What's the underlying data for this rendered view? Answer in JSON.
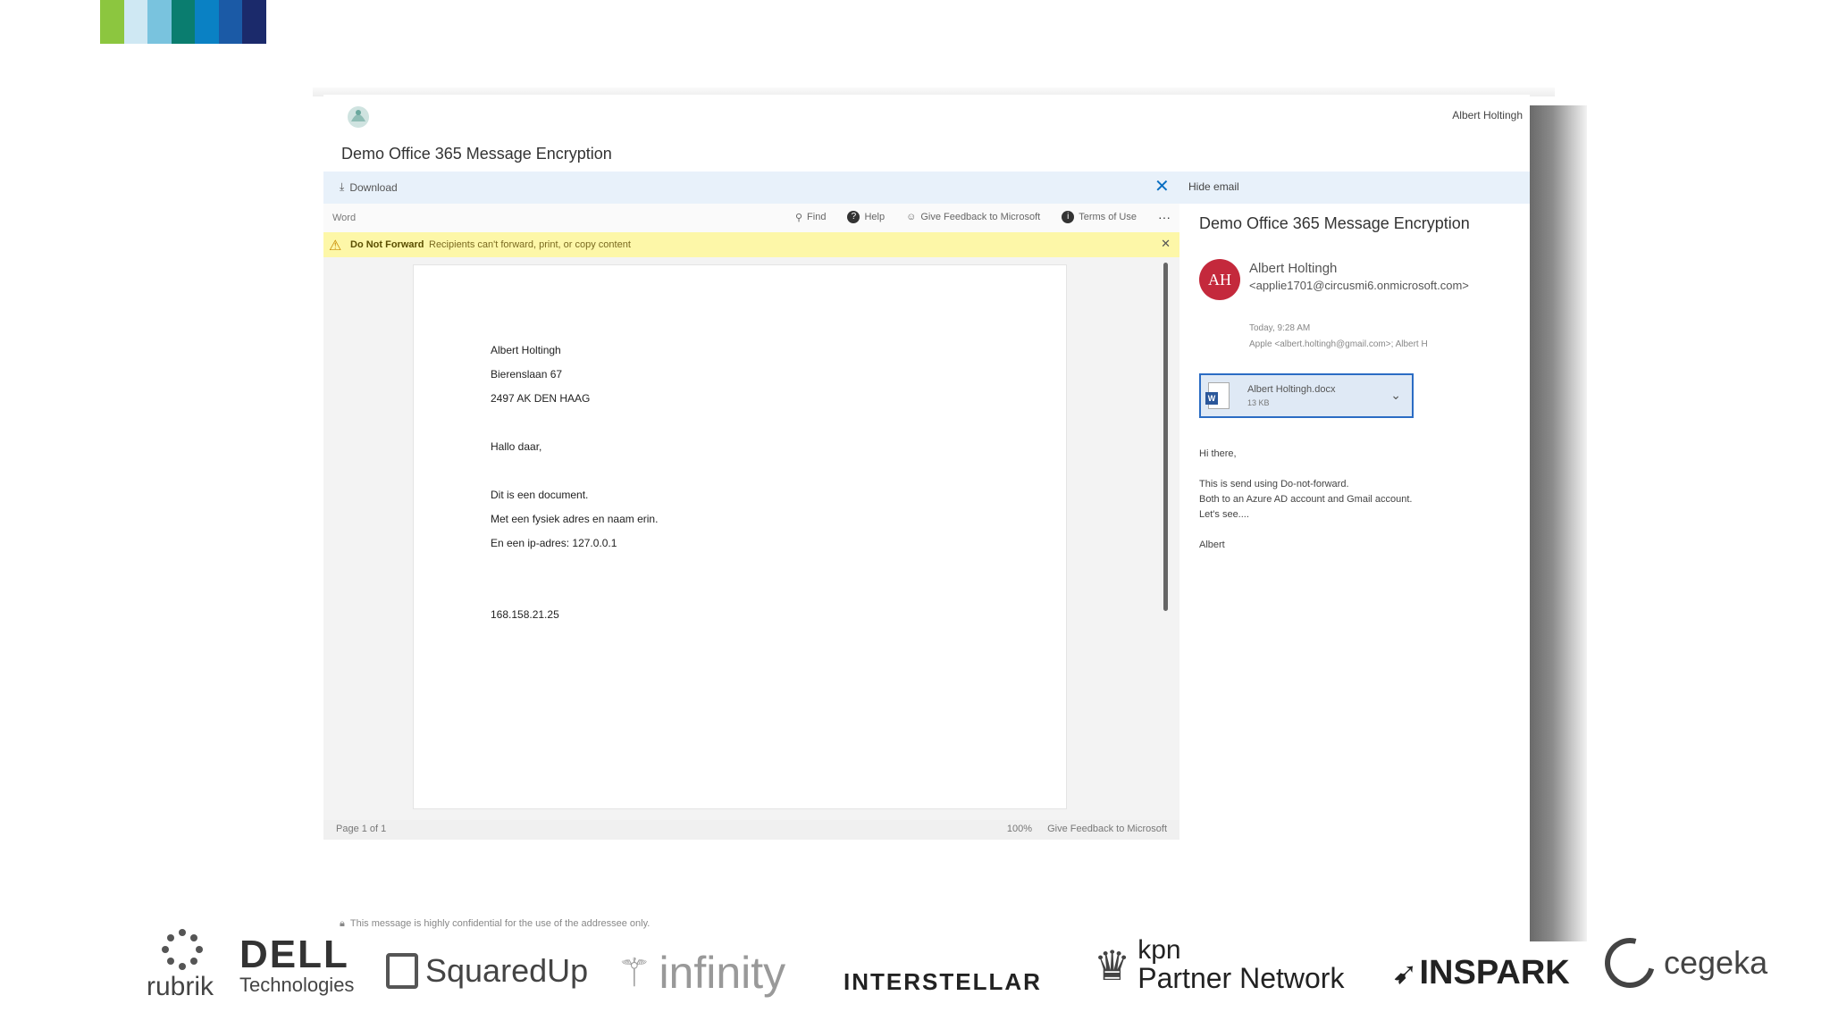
{
  "colors": {
    "colorbar": [
      "#8cc63f",
      "#cfe8f3",
      "#79c3de",
      "#0a7d6f",
      "#0a81c4",
      "#1b5aa6",
      "#1b2a6b"
    ],
    "avatar": "#c4293c",
    "accent": "#0a6fc2",
    "warning_bg": "#fdf7a8"
  },
  "window": {
    "user_name": "Albert Holtingh",
    "title": "Demo Office 365 Message Encryption",
    "download_label": "Download",
    "hide_email_label": "Hide email"
  },
  "viewer": {
    "app_label": "Word",
    "toolbar": {
      "find": "Find",
      "help": "Help",
      "feedback": "Give Feedback to Microsoft",
      "terms": "Terms of Use",
      "more": "···"
    },
    "warning": {
      "title": "Do Not Forward",
      "text": "Recipients can't forward, print, or copy content"
    },
    "document_lines": [
      "Albert Holtingh",
      "Bierenslaan 67",
      "2497 AK DEN HAAG",
      "Hallo daar,",
      "Dit is een document.",
      "Met een fysiek adres en naam erin.",
      "En een ip-adres: 127.0.0.1",
      "168.158.21.25"
    ],
    "status": {
      "page": "Page 1 of 1",
      "zoom": "100%",
      "feedback": "Give Feedback to Microsoft"
    }
  },
  "mail": {
    "subject": "Demo Office 365 Message Encryption",
    "avatar_initials": "AH",
    "sender_name": "Albert Holtingh",
    "sender_email": "<applie1701@circusmi6.onmicrosoft.com>",
    "time": "Today, 9:28 AM",
    "recipients": "Apple <albert.holtingh@gmail.com>; Albert H",
    "attachment": {
      "name": "Albert Holtingh.docx",
      "size": "13 KB"
    },
    "body": [
      "Hi there,",
      "This is send using Do-not-forward.",
      "Both to an Azure AD account and Gmail account.",
      "Let's see....",
      "Albert"
    ]
  },
  "footer_note": "This message is highly confidential for the use of the addressee only.",
  "partners": {
    "rubrik": "rubrik",
    "dell": "DELL",
    "dell_sub": "Technologies",
    "squaredup": "SquaredUp",
    "infinity": "infinity",
    "interstellar": "INTERSTELLAR",
    "kpn": "kpn",
    "kpn_sub": "Partner Network",
    "inspark": "INSPARK",
    "cegeka": "cegeka"
  }
}
